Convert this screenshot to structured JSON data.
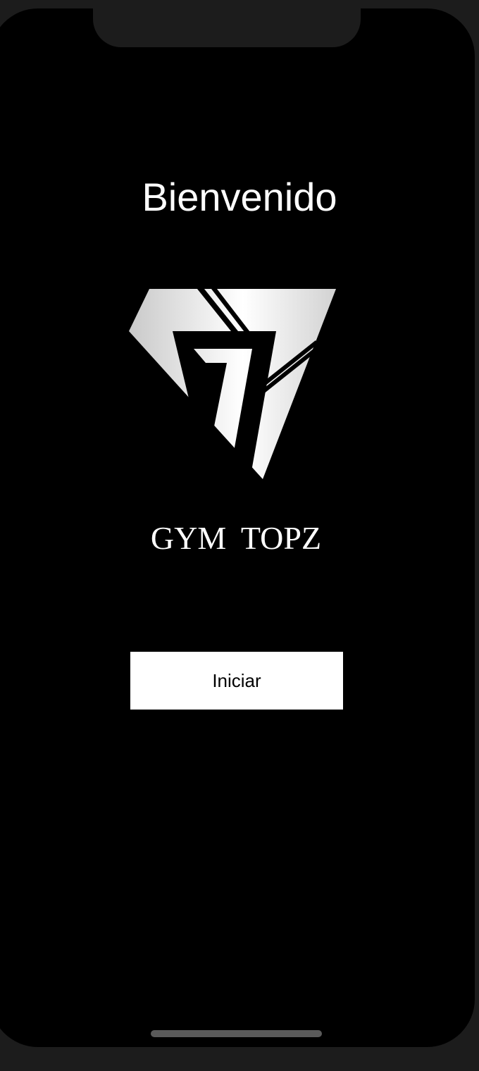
{
  "welcome": {
    "title": "Bienvenido"
  },
  "brand": {
    "name": "GYM  TOPZ",
    "logo_icon": "gym-topz-logo-icon"
  },
  "actions": {
    "start_label": "Iniciar"
  },
  "colors": {
    "background": "#000000",
    "frame": "#1c1c1c",
    "text": "#ffffff",
    "button_background": "#ffffff",
    "button_text": "#000000"
  }
}
